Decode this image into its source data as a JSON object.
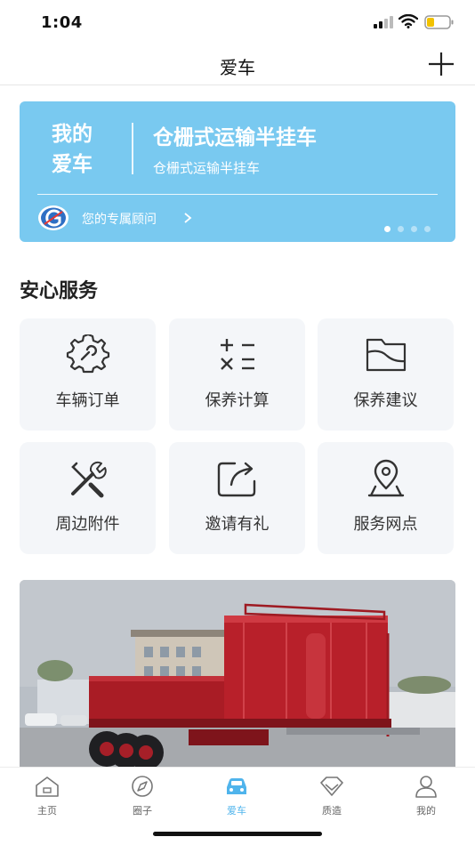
{
  "status_bar": {
    "time": "1:04"
  },
  "nav": {
    "title": "爱车"
  },
  "car_card": {
    "heading_line1": "我的",
    "heading_line2": "爱车",
    "title": "仓栅式运输半挂车",
    "subtitle": "仓栅式运输半挂车",
    "advisor_label": "您的专属顾问",
    "pager": {
      "total": 4,
      "active": 1
    }
  },
  "services": {
    "title": "安心服务",
    "items": [
      {
        "label": "车辆订单",
        "icon": "gear-wrench-icon"
      },
      {
        "label": "保养计算",
        "icon": "calculator-icon"
      },
      {
        "label": "保养建议",
        "icon": "folder-chart-icon"
      },
      {
        "label": "周边附件",
        "icon": "tools-icon"
      },
      {
        "label": "邀请有礼",
        "icon": "share-icon"
      },
      {
        "label": "服务网点",
        "icon": "location-pin-icon"
      }
    ]
  },
  "tabs": [
    {
      "label": "主页",
      "icon": "home-icon",
      "active": false
    },
    {
      "label": "圈子",
      "icon": "compass-icon",
      "active": false
    },
    {
      "label": "爱车",
      "icon": "car-icon",
      "active": true
    },
    {
      "label": "质造",
      "icon": "diamond-icon",
      "active": false
    },
    {
      "label": "我的",
      "icon": "user-icon",
      "active": false
    }
  ],
  "colors": {
    "card_bg": "#79c9f0",
    "accent": "#4fb4ec",
    "tile_bg": "#f4f6f9",
    "truck_red": "#b8202a"
  }
}
